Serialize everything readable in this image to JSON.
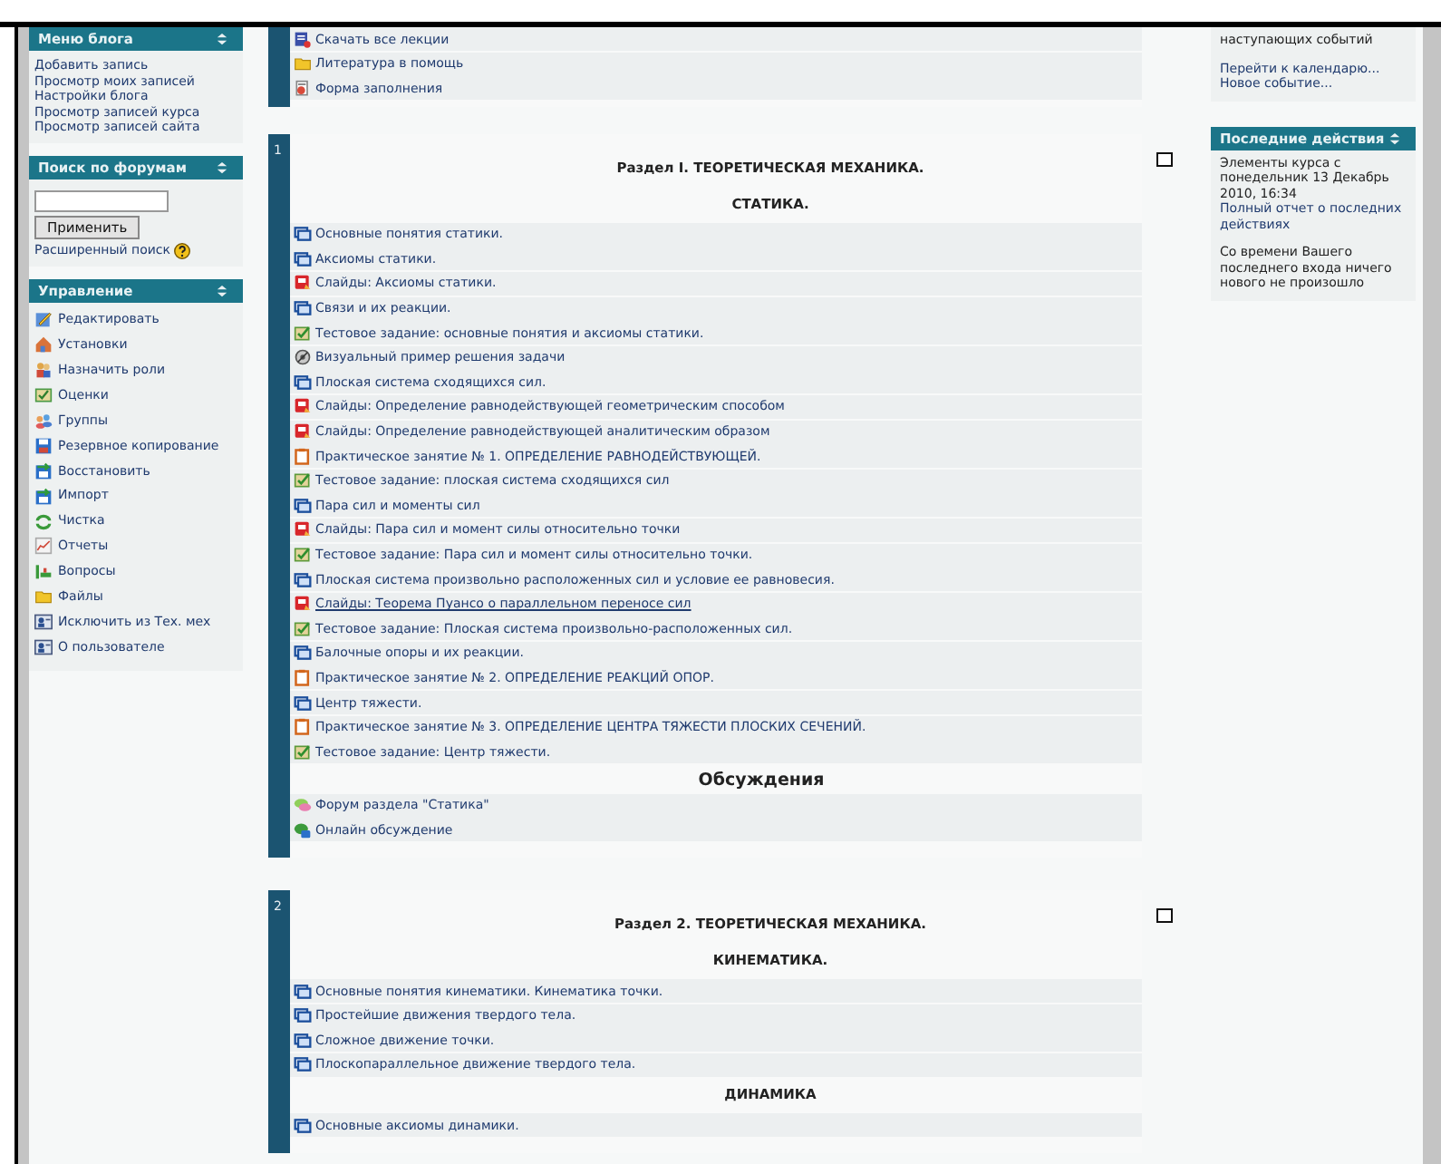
{
  "blog_menu": {
    "title": "Меню блога",
    "links": [
      "Добавить запись",
      "Просмотр моих записей",
      "Настройки блога",
      "Просмотр записей курса",
      "Просмотр записей сайта"
    ]
  },
  "forum_search": {
    "title": "Поиск по форумам",
    "button": "Применить",
    "advanced": "Расширенный поиск"
  },
  "admin": {
    "title": "Управление",
    "items": [
      {
        "label": "Редактировать",
        "kind": "edit"
      },
      {
        "label": "Установки",
        "kind": "settings"
      },
      {
        "label": "Назначить роли",
        "kind": "roles"
      },
      {
        "label": "Оценки",
        "kind": "grades"
      },
      {
        "label": "Группы",
        "kind": "groups"
      },
      {
        "label": "Резервное копирование",
        "kind": "backup"
      },
      {
        "label": "Восстановить",
        "kind": "restore"
      },
      {
        "label": "Импорт",
        "kind": "restore"
      },
      {
        "label": "Чистка",
        "kind": "reset"
      },
      {
        "label": "Отчеты",
        "kind": "reports"
      },
      {
        "label": "Вопросы",
        "kind": "questions"
      },
      {
        "label": "Файлы",
        "kind": "folder"
      },
      {
        "label": "Исключить из Тех. мех",
        "kind": "user"
      },
      {
        "label": "О пользователе",
        "kind": "user"
      }
    ]
  },
  "sections": [
    {
      "content": [
        {
          "kind": "download",
          "label": "Скачать все лекции",
          "underlined": false
        },
        {
          "kind": "folder",
          "label": "Литература в помощь",
          "underlined": false
        },
        {
          "kind": "form",
          "label": "Форма заполнения",
          "underlined": false
        }
      ]
    },
    {
      "number": "1",
      "highlighted": false,
      "content": [
        {
          "kind": "title",
          "label": "Раздел I. ТЕОРЕТИЧЕСКАЯ МЕХАНИКА."
        },
        {
          "kind": "title",
          "label": "СТАТИКА."
        },
        {
          "kind": "page",
          "label": "Основные понятия статики.",
          "underlined": false
        },
        {
          "kind": "page",
          "label": "Аксиомы статики.",
          "underlined": false
        },
        {
          "kind": "slides",
          "label": "Слайды: Аксиомы статики.",
          "underlined": false
        },
        {
          "kind": "page",
          "label": "Связи и их реакции.",
          "underlined": false
        },
        {
          "kind": "quiz",
          "label": "Тестовое задание: основные понятия и аксиомы статики.",
          "underlined": false
        },
        {
          "kind": "visual",
          "label": "Визуальный пример решения задачи",
          "underlined": false
        },
        {
          "kind": "page",
          "label": "Плоская система сходящихся сил.",
          "underlined": false
        },
        {
          "kind": "slides",
          "label": "Слайды: Определение равнодействующей геометрическим способом",
          "underlined": false
        },
        {
          "kind": "slides",
          "label": "Слайды: Определение равнодействующей аналитическим образом",
          "underlined": false
        },
        {
          "kind": "practice",
          "label": "Практическое занятие № 1. ОПРЕДЕЛЕНИЕ РАВНОДЕЙСТВУЮЩЕЙ.",
          "underlined": false
        },
        {
          "kind": "quiz",
          "label": "Тестовое задание: плоская система сходящихся сил",
          "underlined": false
        },
        {
          "kind": "page",
          "label": "Пара сил и моменты сил",
          "underlined": false
        },
        {
          "kind": "slides",
          "label": "Слайды: Пара сил и момент силы относительно точки",
          "underlined": false
        },
        {
          "kind": "quiz",
          "label": "Тестовое задание: Пара сил и момент силы относительно точки.",
          "underlined": false
        },
        {
          "kind": "page",
          "label": "Плоская система произвольно расположенных сил и условие ее равновесия.",
          "underlined": false
        },
        {
          "kind": "slides",
          "label": "Слайды: Теорема Пуансо о параллельном переносе сил",
          "underlined": true
        },
        {
          "kind": "quiz",
          "label": "Тестовое задание: Плоская система произвольно-расположенных сил.",
          "underlined": false
        },
        {
          "kind": "page",
          "label": "Балочные опоры и их реакции.",
          "underlined": false
        },
        {
          "kind": "practice",
          "label": "Практическое занятие № 2. ОПРЕДЕЛЕНИЕ РЕАКЦИЙ ОПОР.",
          "underlined": false
        },
        {
          "kind": "page",
          "label": "Центр тяжести.",
          "underlined": false
        },
        {
          "kind": "practice",
          "label": "Практическое занятие № 3. ОПРЕДЕЛЕНИЕ ЦЕНТРА ТЯЖЕСТИ ПЛОСКИХ СЕЧЕНИЙ.",
          "underlined": false
        },
        {
          "kind": "quiz",
          "label": "Тестовое задание: Центр тяжести.",
          "underlined": false
        },
        {
          "kind": "subheading",
          "label": "Обсуждения"
        },
        {
          "kind": "forum",
          "label": "Форум раздела \"Статика\"",
          "underlined": false
        },
        {
          "kind": "chat",
          "label": "Онлайн обсуждение",
          "underlined": false
        }
      ]
    },
    {
      "number": "2",
      "highlighted": false,
      "content": [
        {
          "kind": "title",
          "label": "Раздел 2. ТЕОРЕТИЧЕСКАЯ МЕХАНИКА."
        },
        {
          "kind": "title",
          "label": "КИНЕМАТИКА."
        },
        {
          "kind": "page",
          "label": "Основные понятия кинематики. Кинематика точки.",
          "underlined": false
        },
        {
          "kind": "page",
          "label": "Простейшие движения твердого тела.",
          "underlined": false
        },
        {
          "kind": "page",
          "label": "Сложное движение точки.",
          "underlined": false
        },
        {
          "kind": "page",
          "label": "Плоскопараллельное движение твердого тела.",
          "underlined": false
        },
        {
          "kind": "title",
          "label": "ДИНАМИКА"
        },
        {
          "kind": "page",
          "label": "Основные аксиомы динамики.",
          "underlined": false
        }
      ]
    }
  ],
  "calendar": {
    "text": "наступающих событий",
    "links": [
      "Перейти к календарю...",
      "Новое событие..."
    ]
  },
  "recent": {
    "title": "Последние действия",
    "since": "Элементы курса с понедельник 13 Декабрь 2010, 16:34",
    "link": "Полный отчет о последних действиях",
    "note": "Со времени Вашего последнего входа ничего нового не произошло"
  }
}
